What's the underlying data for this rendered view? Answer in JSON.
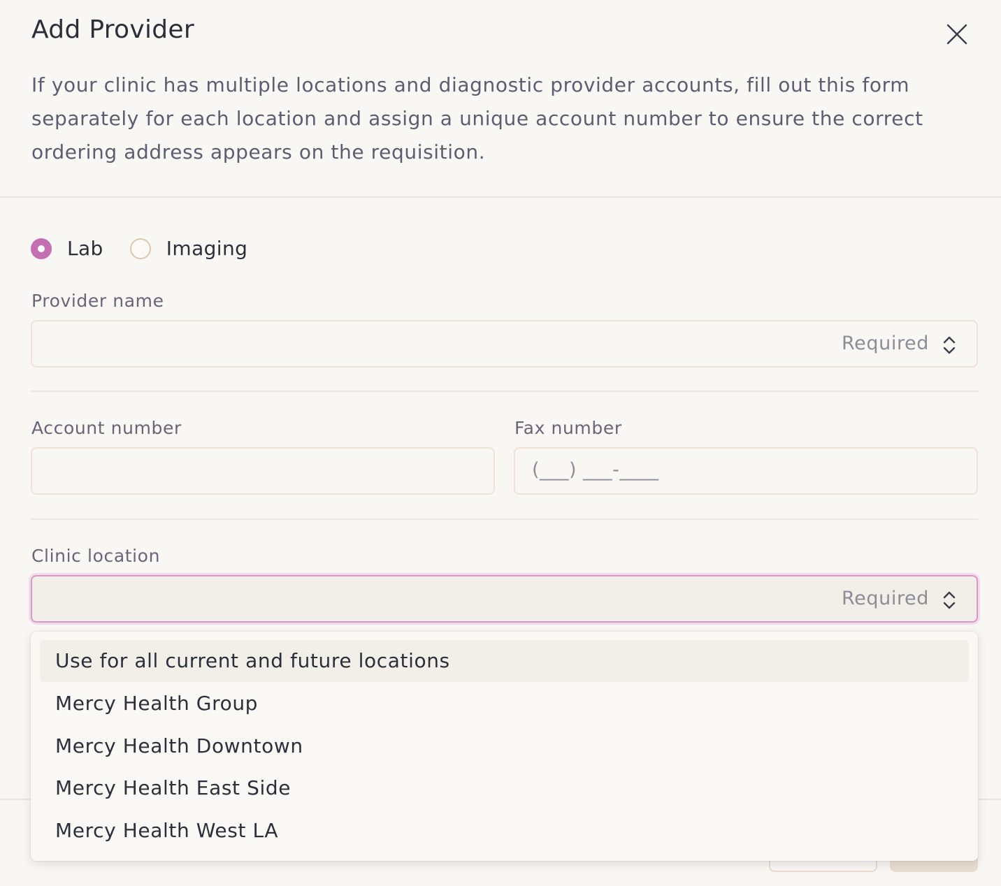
{
  "modal": {
    "title": "Add Provider",
    "description": "If your clinic has multiple locations and diagnostic provider accounts, fill out this form separately for each location and assign a unique account number to ensure the correct ordering address appears on the requisition.",
    "close_icon": "close-icon"
  },
  "provider_type": {
    "options": [
      {
        "label": "Lab",
        "selected": true
      },
      {
        "label": "Imaging",
        "selected": false
      }
    ]
  },
  "fields": {
    "provider_name": {
      "label": "Provider name",
      "placeholder": "Required"
    },
    "account_number": {
      "label": "Account number",
      "value": ""
    },
    "fax_number": {
      "label": "Fax number",
      "mask": "(___) ___-____"
    },
    "clinic_location": {
      "label": "Clinic location",
      "placeholder": "Required"
    }
  },
  "clinic_location_dropdown": {
    "options": [
      "Use for all current and future locations",
      "Mercy Health Group",
      "Mercy Health Downtown",
      "Mercy Health East Side",
      "Mercy Health West LA"
    ],
    "highlighted_index": 0
  },
  "colors": {
    "accent": "#c36fb2",
    "background": "#f9f7f4",
    "border": "#efe2d6"
  }
}
